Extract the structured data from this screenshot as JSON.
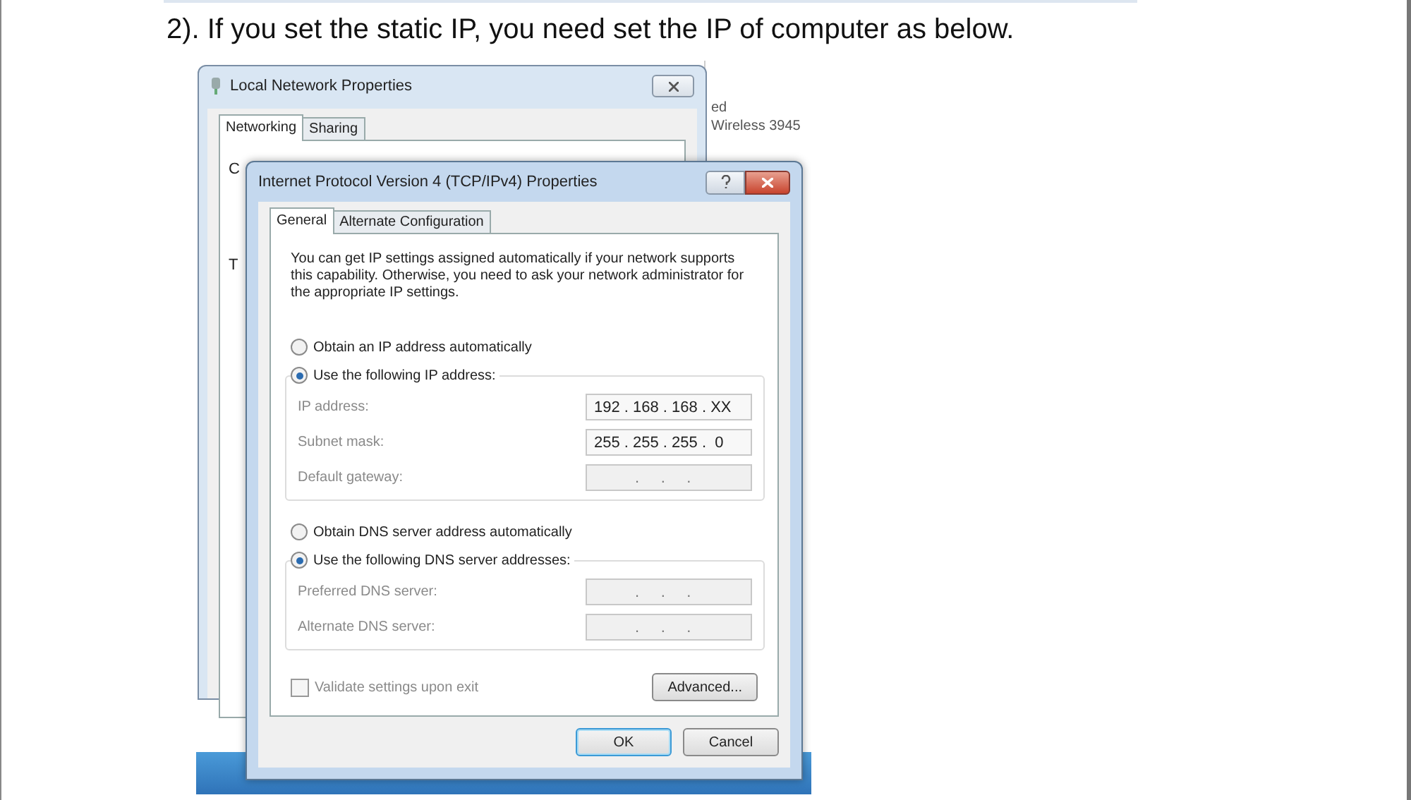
{
  "heading": "2). If you set the static IP, you need set the IP of computer as below.",
  "background_window": {
    "lines": [
      "ed",
      "Wireless 3945"
    ]
  },
  "back_dialog": {
    "title": "Local Netework Properties",
    "tabs": [
      {
        "label": "Networking",
        "selected": true
      },
      {
        "label": "Sharing",
        "selected": false
      }
    ],
    "peek_texts": [
      "C",
      "T"
    ]
  },
  "dialog": {
    "title": "Internet Protocol Version 4 (TCP/IPv4) Properties",
    "tabs": [
      {
        "label": "General",
        "selected": true
      },
      {
        "label": "Alternate Configuration",
        "selected": false
      }
    ],
    "description": "You can get IP settings assigned automatically if your network supports this capability. Otherwise, you need to ask your network administrator for the appropriate IP settings.",
    "ip_options": [
      {
        "label": "Obtain an IP address automatically",
        "selected": false
      },
      {
        "label": "Use the following IP address:",
        "selected": true
      }
    ],
    "ip_fields": [
      {
        "label": "IP address:",
        "value": "192 . 168 . 168 . XX"
      },
      {
        "label": "Subnet mask:",
        "value": "255 . 255 . 255 .  0"
      },
      {
        "label": "Default gateway:",
        "value": ".     .     ."
      }
    ],
    "dns_options": [
      {
        "label": "Obtain DNS server address automatically",
        "selected": false
      },
      {
        "label": "Use the following DNS server addresses:",
        "selected": true
      }
    ],
    "dns_fields": [
      {
        "label": "Preferred DNS server:",
        "value": ".     .     ."
      },
      {
        "label": "Alternate DNS server:",
        "value": ".     .     ."
      }
    ],
    "validate": {
      "label": "Validate settings upon exit",
      "checked": false
    },
    "advanced": "Advanced...",
    "buttons": [
      {
        "label": "OK",
        "kind": "default"
      },
      {
        "label": "Cancel",
        "kind": "normal"
      }
    ]
  }
}
